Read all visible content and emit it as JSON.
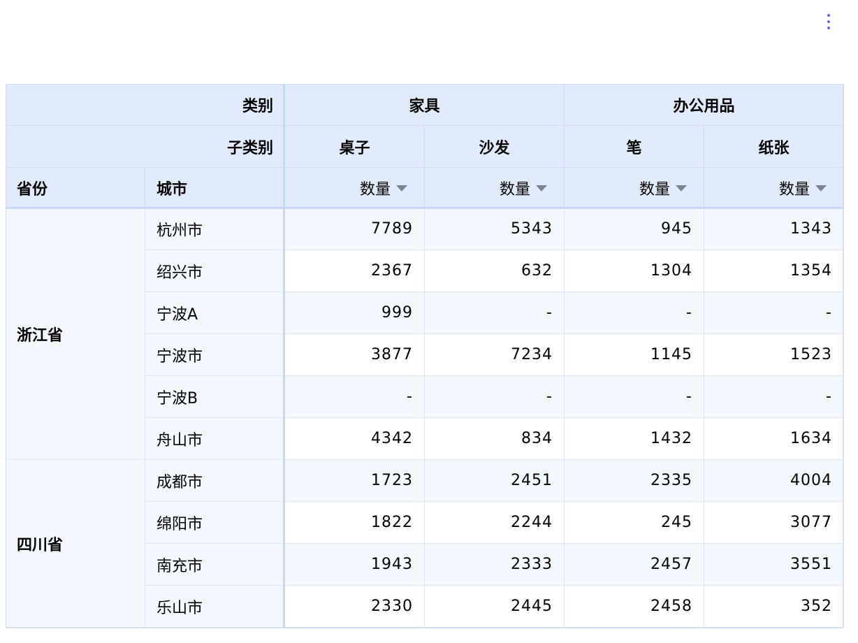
{
  "menu": {
    "icon": "more-vertical-icon"
  },
  "pivot": {
    "corner": {
      "col_level1_label": "类别",
      "col_level2_label": "子类别",
      "row_fields": [
        "省份",
        "城市"
      ]
    },
    "categories": [
      {
        "label": "家具",
        "subcategories": [
          "桌子",
          "沙发"
        ]
      },
      {
        "label": "办公用品",
        "subcategories": [
          "笔",
          "纸张"
        ]
      }
    ],
    "measure_label": "数量",
    "provinces": [
      {
        "label": "浙江省",
        "cities": [
          {
            "label": "杭州市",
            "values": [
              "7789",
              "5343",
              "945",
              "1343"
            ]
          },
          {
            "label": "绍兴市",
            "values": [
              "2367",
              "632",
              "1304",
              "1354"
            ]
          },
          {
            "label": "宁波A",
            "values": [
              "999",
              "-",
              "-",
              "-"
            ]
          },
          {
            "label": "宁波市",
            "values": [
              "3877",
              "7234",
              "1145",
              "1523"
            ]
          },
          {
            "label": "宁波B",
            "values": [
              "-",
              "-",
              "-",
              "-"
            ]
          },
          {
            "label": "舟山市",
            "values": [
              "4342",
              "834",
              "1432",
              "1634"
            ]
          }
        ]
      },
      {
        "label": "四川省",
        "cities": [
          {
            "label": "成都市",
            "values": [
              "1723",
              "2451",
              "2335",
              "4004"
            ]
          },
          {
            "label": "绵阳市",
            "values": [
              "1822",
              "2244",
              "245",
              "3077"
            ]
          },
          {
            "label": "南充市",
            "values": [
              "1943",
              "2333",
              "2457",
              "3551"
            ]
          },
          {
            "label": "乐山市",
            "values": [
              "2330",
              "2445",
              "2458",
              "352"
            ]
          }
        ]
      }
    ]
  }
}
